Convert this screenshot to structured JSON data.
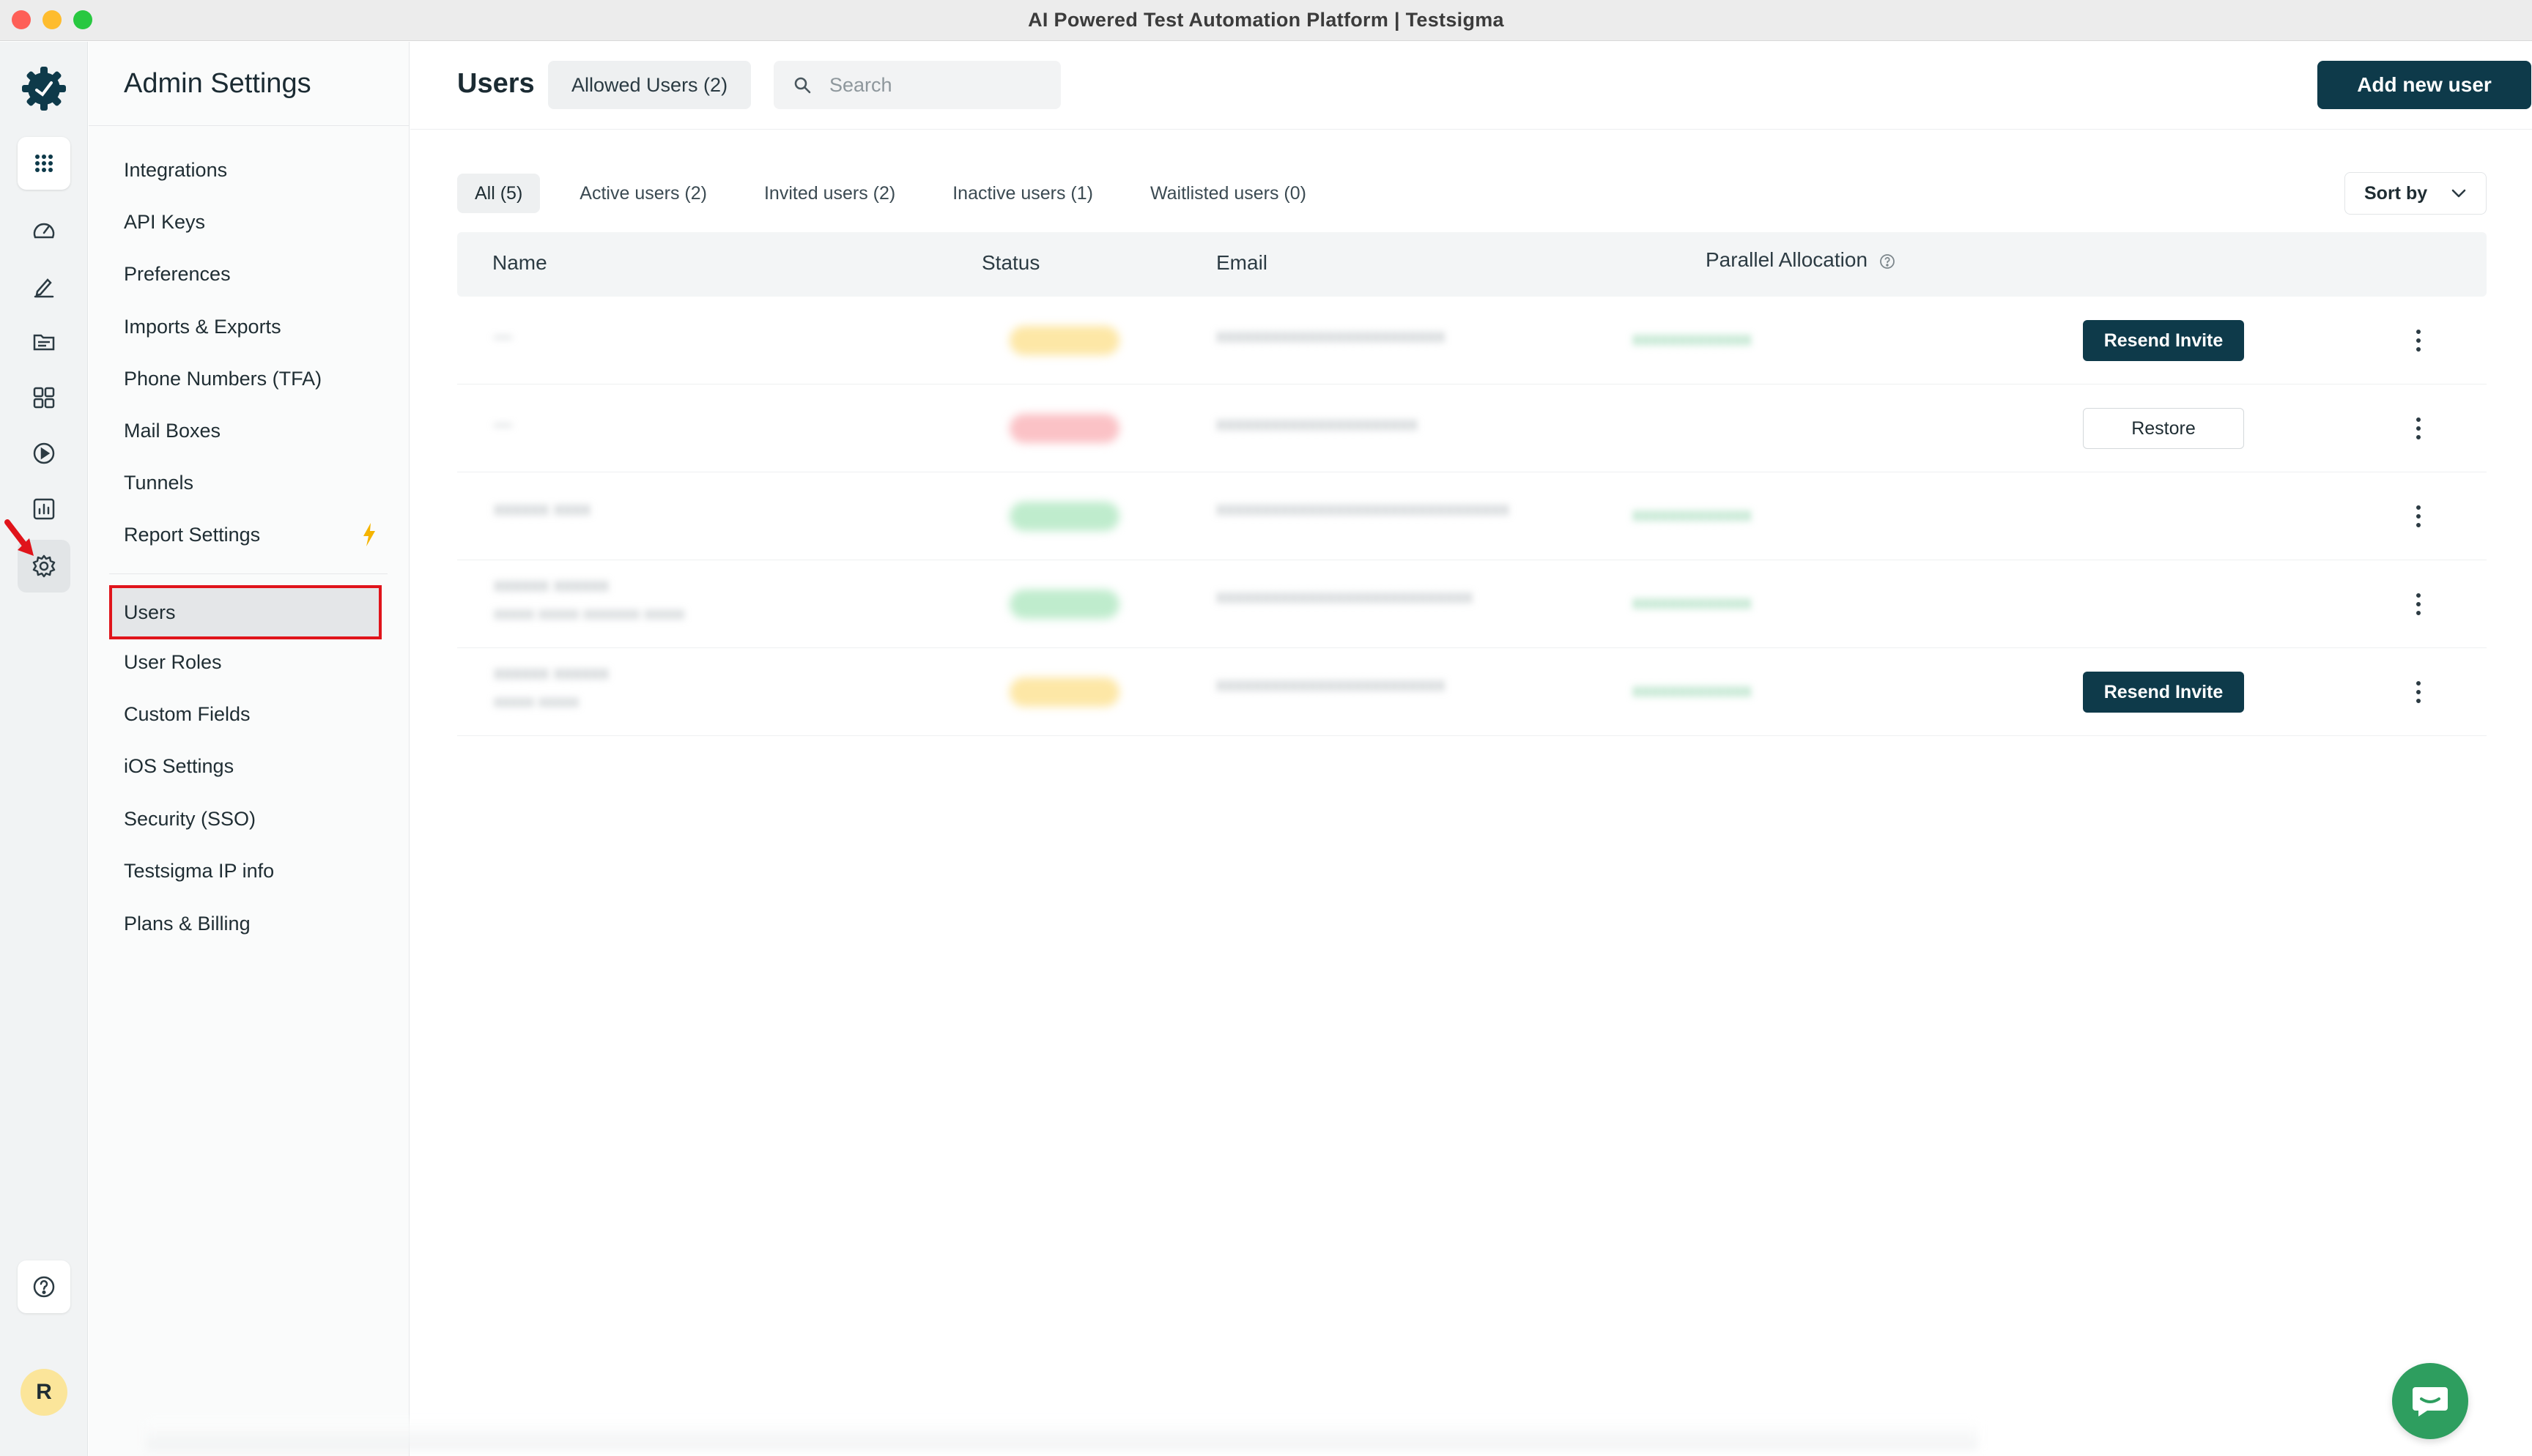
{
  "window": {
    "title": "AI Powered Test Automation Platform | Testsigma"
  },
  "rail": {
    "icons": [
      "apps-grid-icon",
      "dashboard-icon",
      "pencil-icon",
      "folder-icon",
      "grid-icon",
      "play-icon",
      "report-icon",
      "settings-icon"
    ],
    "avatar_initial": "R"
  },
  "settings_menu": {
    "heading": "Admin Settings",
    "group1": [
      "Integrations",
      "API Keys",
      "Preferences",
      "Imports & Exports",
      "Phone Numbers (TFA)",
      "Mail Boxes",
      "Tunnels",
      "Report Settings"
    ],
    "selected": "Users",
    "group2": [
      "User Roles",
      "Custom Fields",
      "iOS Settings",
      "Security (SSO)",
      "Testsigma IP info",
      "Plans & Billing"
    ]
  },
  "header": {
    "title": "Users",
    "allowed_users": "Allowed Users (2)",
    "search_placeholder": "Search",
    "add_button": "Add new user"
  },
  "filters": {
    "tabs": [
      "All (5)",
      "Active users (2)",
      "Invited users (2)",
      "Inactive users (1)",
      "Waitlisted users (0)"
    ],
    "active": "All (5)",
    "sort_label": "Sort by"
  },
  "table": {
    "columns": {
      "name": "Name",
      "status": "Status",
      "email": "Email",
      "parallel": "Parallel Allocation"
    },
    "rows": [
      {
        "status_color": "#fde7a6",
        "action": "Resend Invite",
        "action_style": "dark"
      },
      {
        "status_color": "#fbc2c6",
        "action": "Restore",
        "action_style": "light"
      },
      {
        "status_color": "#bfeccd",
        "action": "",
        "action_style": ""
      },
      {
        "status_color": "#bfeccd",
        "action": "",
        "action_style": ""
      },
      {
        "status_color": "#fde7a6",
        "action": "Resend Invite",
        "action_style": "dark"
      }
    ]
  },
  "colors": {
    "primary": "#0e3a4a",
    "highlight_border": "#e0141b",
    "chat": "#2e9e5f"
  }
}
